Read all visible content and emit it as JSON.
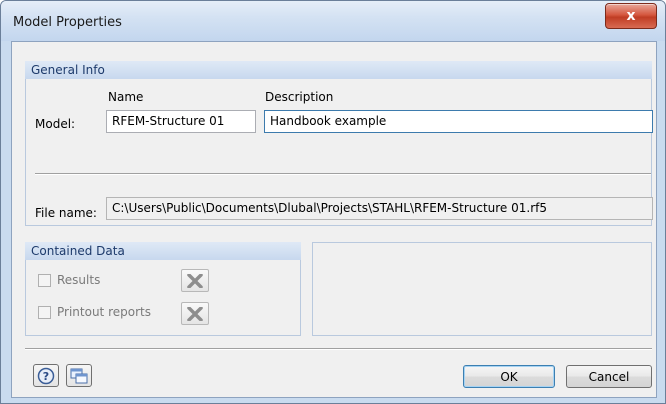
{
  "window": {
    "title": "Model Properties",
    "close_label": "x"
  },
  "general_info": {
    "header": "General Info",
    "name_label": "Name",
    "description_label": "Description",
    "model_label": "Model:",
    "name_value": "RFEM-Structure 01",
    "description_value": "Handbook example",
    "file_name_label": "File name:",
    "file_name_value": "C:\\Users\\Public\\Documents\\Dlubal\\Projects\\STAHL\\RFEM-Structure 01.rf5"
  },
  "contained_data": {
    "header": "Contained Data",
    "items": [
      {
        "label": "Results",
        "checked": false,
        "delete_icon": "x-delete-icon"
      },
      {
        "label": "Printout reports",
        "checked": false,
        "delete_icon": "x-delete-icon"
      }
    ]
  },
  "footer": {
    "help_icon": "help-icon",
    "windows_icon": "windows-icon",
    "ok_label": "OK",
    "cancel_label": "Cancel"
  }
}
